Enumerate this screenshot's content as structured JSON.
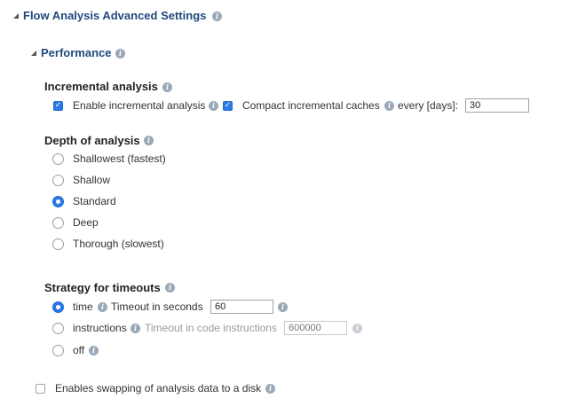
{
  "flow_analysis": {
    "title": "Flow Analysis Advanced Settings",
    "performance": {
      "title": "Performance",
      "incremental": {
        "title": "Incremental analysis",
        "enable_label": "Enable incremental analysis",
        "enable_checked": true,
        "compact_label": "Compact incremental caches",
        "compact_checked": true,
        "every_label": "every [days]:",
        "days_value": "30"
      },
      "depth": {
        "title": "Depth of analysis",
        "options": [
          {
            "label": "Shallowest (fastest)",
            "checked": false
          },
          {
            "label": "Shallow",
            "checked": false
          },
          {
            "label": "Standard",
            "checked": true
          },
          {
            "label": "Deep",
            "checked": false
          },
          {
            "label": "Thorough (slowest)",
            "checked": false
          }
        ]
      },
      "timeouts": {
        "title": "Strategy for timeouts",
        "time": {
          "label": "time",
          "sub_label": "Timeout in seconds",
          "value": "60",
          "checked": true
        },
        "instructions": {
          "label": "instructions",
          "sub_label": "Timeout in code instructions",
          "placeholder": "600000",
          "checked": false
        },
        "off": {
          "label": "off",
          "checked": false
        }
      }
    },
    "swapping": {
      "label": "Enables swapping of analysis data to a disk",
      "checked": false
    }
  },
  "icons": {
    "info": "info-icon",
    "collapse": "collapse-triangle-icon",
    "check": "checkmark-icon"
  },
  "colors": {
    "accent": "#2a7ae4",
    "section_title": "#1f4a7c",
    "info_icon": "#9aa8b8"
  }
}
